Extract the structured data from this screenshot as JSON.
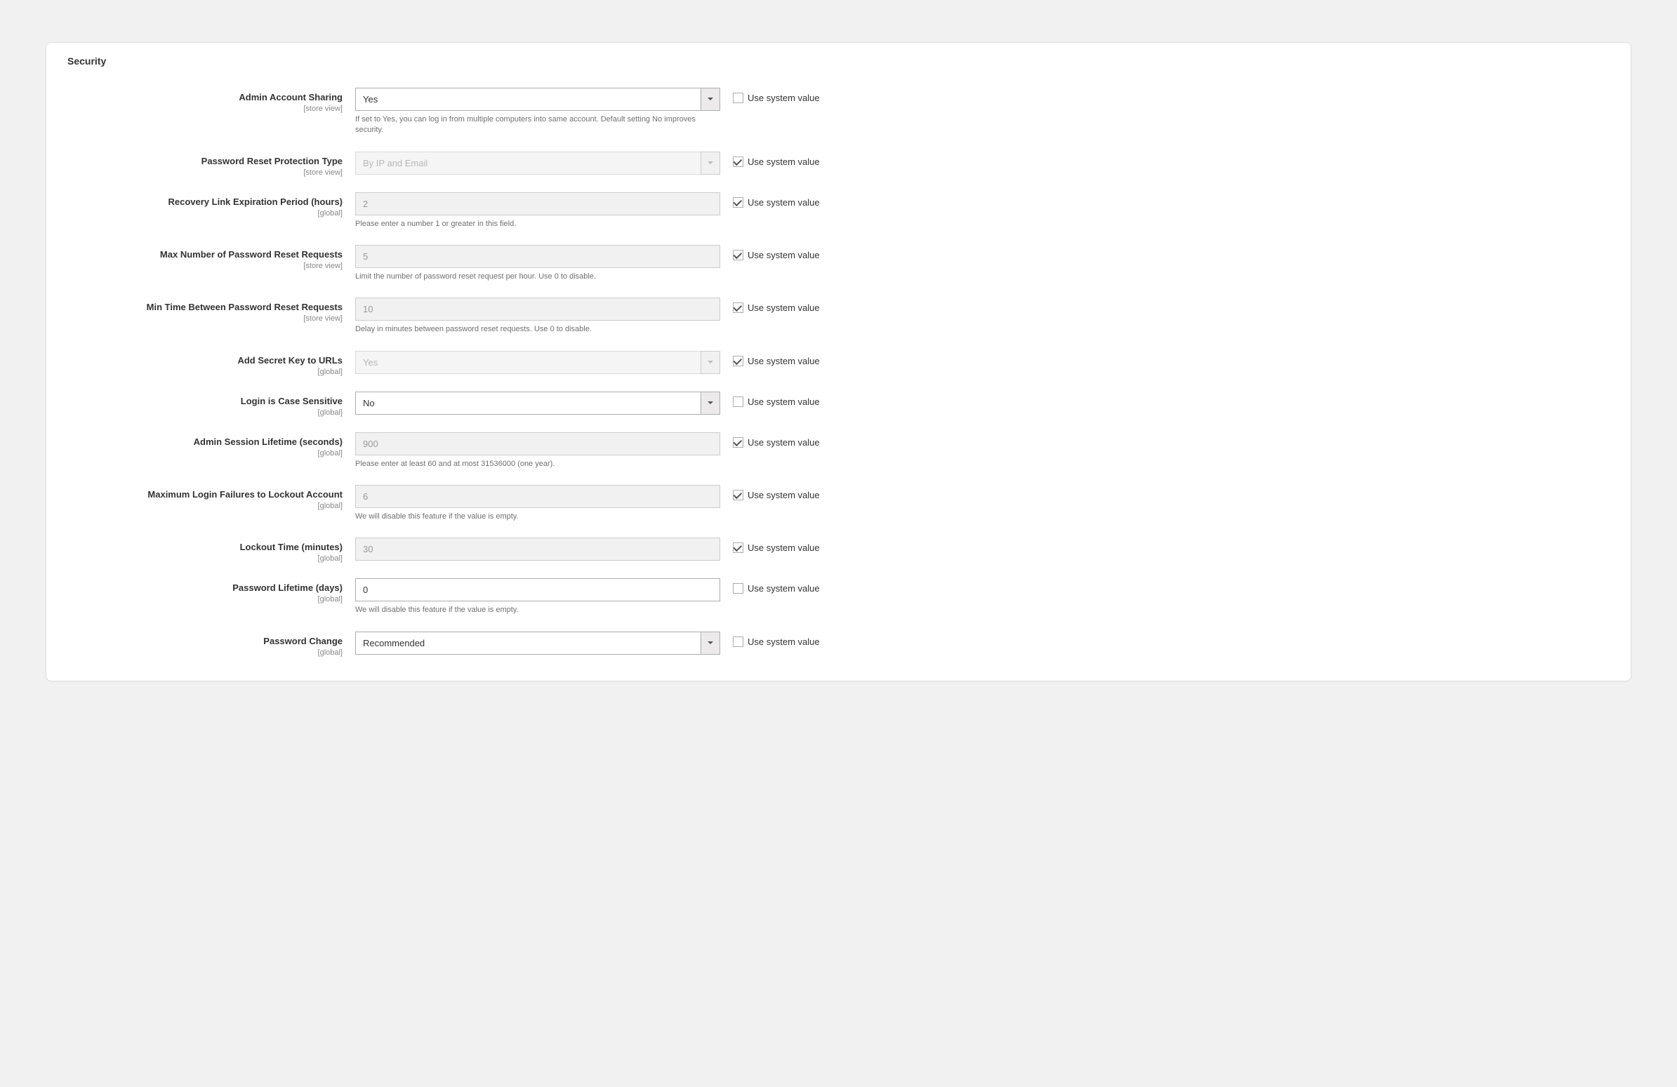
{
  "section": {
    "title": "Security"
  },
  "common": {
    "use_system_value": "Use system value",
    "scope_store_view": "[store view]",
    "scope_global": "[global]"
  },
  "fields": {
    "admin_account_sharing": {
      "label": "Admin Account Sharing",
      "value": "Yes",
      "help": "If set to Yes, you can log in from multiple computers into same account. Default setting No improves security.",
      "use_system": false
    },
    "password_reset_protection": {
      "label": "Password Reset Protection Type",
      "value": "By IP and Email",
      "use_system": true
    },
    "recovery_link_expiration": {
      "label": "Recovery Link Expiration Period (hours)",
      "value": "2",
      "help": "Please enter a number 1 or greater in this field.",
      "use_system": true
    },
    "max_password_reset_requests": {
      "label": "Max Number of Password Reset Requests",
      "value": "5",
      "help": "Limit the number of password reset request per hour. Use 0 to disable.",
      "use_system": true
    },
    "min_time_between_reset": {
      "label": "Min Time Between Password Reset Requests",
      "value": "10",
      "help": "Delay in minutes between password reset requests. Use 0 to disable.",
      "use_system": true
    },
    "add_secret_key": {
      "label": "Add Secret Key to URLs",
      "value": "Yes",
      "use_system": true
    },
    "login_case_sensitive": {
      "label": "Login is Case Sensitive",
      "value": "No",
      "use_system": false
    },
    "session_lifetime": {
      "label": "Admin Session Lifetime (seconds)",
      "value": "900",
      "help": "Please enter at least 60 and at most 31536000 (one year).",
      "use_system": true
    },
    "max_login_failures": {
      "label": "Maximum Login Failures to Lockout Account",
      "value": "6",
      "help": "We will disable this feature if the value is empty.",
      "use_system": true
    },
    "lockout_time": {
      "label": "Lockout Time (minutes)",
      "value": "30",
      "use_system": true
    },
    "password_lifetime": {
      "label": "Password Lifetime (days)",
      "value": "0",
      "help": "We will disable this feature if the value is empty.",
      "use_system": false
    },
    "password_change": {
      "label": "Password Change",
      "value": "Recommended",
      "use_system": false
    }
  }
}
